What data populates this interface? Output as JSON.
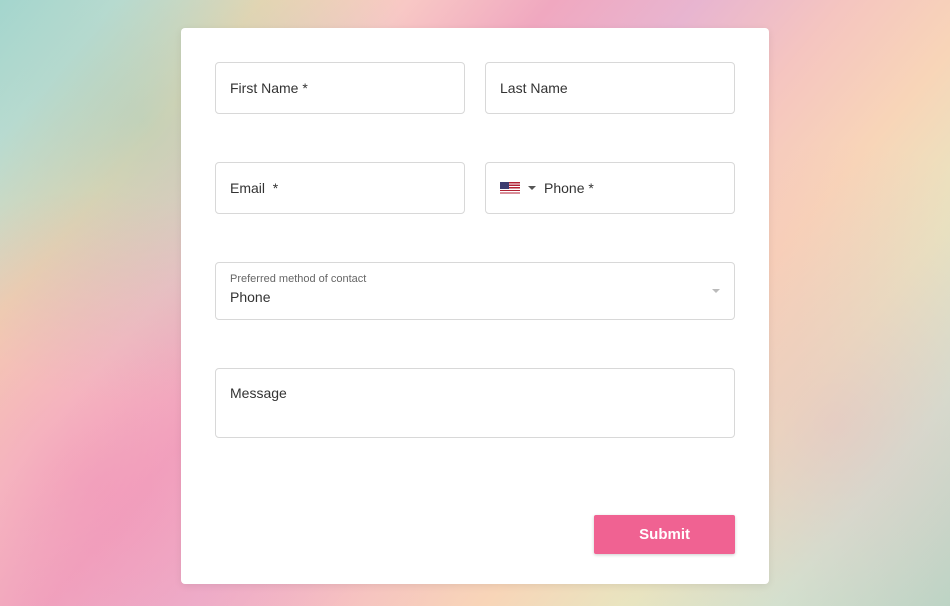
{
  "form": {
    "first_name": {
      "placeholder": "First Name *",
      "value": ""
    },
    "last_name": {
      "placeholder": "Last Name",
      "value": ""
    },
    "email": {
      "placeholder": "Email  *",
      "value": ""
    },
    "phone": {
      "label": "Phone *",
      "country": "US",
      "value": ""
    },
    "preferred_contact": {
      "label": "Preferred method of contact",
      "value": "Phone"
    },
    "message": {
      "placeholder": "Message",
      "value": ""
    },
    "submit_label": "Submit"
  },
  "colors": {
    "accent": "#f06292",
    "border": "#d8d8d8"
  }
}
